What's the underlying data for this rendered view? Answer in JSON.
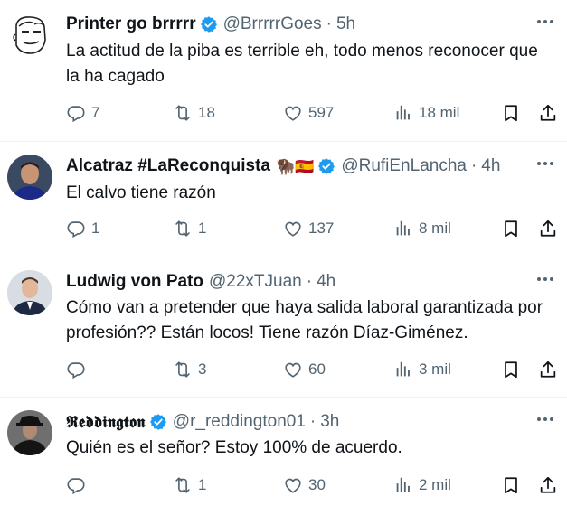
{
  "tweets": [
    {
      "name": "Printer go brrrrr",
      "handle": "@BrrrrrGoes",
      "time": "5h",
      "text": "La actitud de la piba es terrible eh, todo menos reconocer que la ha cagado",
      "replies": "7",
      "retweets": "18",
      "likes": "597",
      "views": "18 mil"
    },
    {
      "name": "Alcatraz #LaReconquista",
      "emojis": "🦬🇪🇸",
      "handle": "@RufiEnLancha",
      "time": "4h",
      "text": "El calvo tiene razón",
      "replies": "1",
      "retweets": "1",
      "likes": "137",
      "views": "8 mil"
    },
    {
      "name": "Ludwig von Pato",
      "handle": "@22xTJuan",
      "time": "4h",
      "text": "Cómo van a pretender que haya salida laboral garantizada por profesión?? Están locos! Tiene razón Díaz-Giménez.",
      "replies": "",
      "retweets": "3",
      "likes": "60",
      "views": "3 mil"
    },
    {
      "name": "𝕽𝖊𝖉𝖉𝖎𝖓𝖌𝖙𝖔𝖓",
      "handle": "@r_reddington01",
      "time": "3h",
      "text": "Quién es el señor? Estoy 100% de acuerdo.",
      "replies": "",
      "retweets": "1",
      "likes": "30",
      "views": "2 mil"
    }
  ],
  "separator": "·",
  "colors": {
    "verified": "#1d9bf0",
    "muted": "#536471",
    "text": "#0f1419"
  },
  "icons": [
    "reply-icon",
    "retweet-icon",
    "like-icon",
    "views-icon",
    "bookmark-icon",
    "share-icon",
    "more-icon",
    "verified-badge-icon"
  ]
}
